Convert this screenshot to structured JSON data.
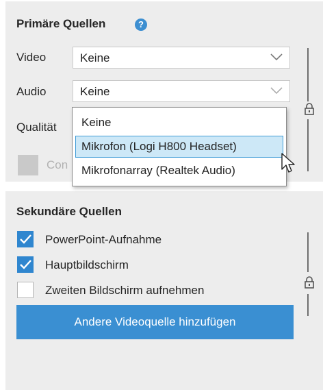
{
  "primary": {
    "title": "Primäre Quellen",
    "help_icon": "question-circle-icon",
    "video": {
      "label": "Video",
      "selected": "Keine"
    },
    "audio": {
      "label": "Audio",
      "selected": "Keine"
    },
    "quality": {
      "label": "Qualität"
    },
    "checkbox_label": "Con"
  },
  "audio_dropdown": {
    "options": [
      "Keine",
      "Mikrofon (Logi H800 Headset)",
      "Mikrofonarray (Realtek Audio)"
    ],
    "highlighted_index": 1
  },
  "secondary": {
    "title": "Sekundäre Quellen",
    "items": [
      {
        "label": "PowerPoint-Aufnahme",
        "checked": true
      },
      {
        "label": "Hauptbildschirm",
        "checked": true
      },
      {
        "label": "Zweiten Bildschirm aufnehmen",
        "checked": false
      }
    ],
    "add_button": "Andere Videoquelle hinzufügen"
  },
  "colors": {
    "accent": "#3a8fd2",
    "panel_bg": "#ededed",
    "highlight_bg": "#cde8f7"
  }
}
